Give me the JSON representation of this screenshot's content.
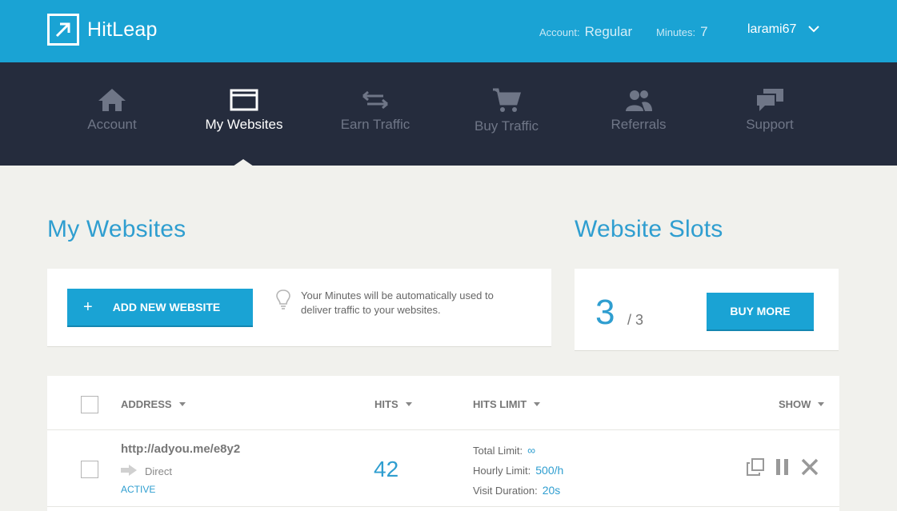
{
  "app": {
    "name": "HitLeap"
  },
  "header": {
    "account_label": "Account:",
    "account_type": "Regular",
    "minutes_label": "Minutes:",
    "minutes_value": "7",
    "username": "larami67"
  },
  "nav": {
    "items": [
      {
        "label": "Account",
        "icon": "home-icon"
      },
      {
        "label": "My Websites",
        "icon": "browser-window-icon",
        "active": true
      },
      {
        "label": "Earn Traffic",
        "icon": "exchange-arrows-icon"
      },
      {
        "label": "Buy Traffic",
        "icon": "shopping-cart-icon"
      },
      {
        "label": "Referrals",
        "icon": "users-icon"
      },
      {
        "label": "Support",
        "icon": "chat-bubbles-icon"
      }
    ]
  },
  "websites": {
    "title": "My Websites",
    "add_button": "ADD NEW WEBSITE",
    "hint": "Your Minutes will be automatically used to deliver traffic to your websites."
  },
  "slots": {
    "title": "Website Slots",
    "used": "3",
    "total": "/ 3",
    "buy_button": "BUY MORE"
  },
  "table": {
    "columns": {
      "address": "ADDRESS",
      "hits": "HITS",
      "hits_limit": "HITS LIMIT",
      "show": "SHOW"
    },
    "rows": [
      {
        "url": "http://adyou.me/e8y2",
        "traffic_type": "Direct",
        "status": "ACTIVE",
        "hits": "42",
        "total_limit_label": "Total Limit:",
        "total_limit": "∞",
        "hourly_limit_label": "Hourly Limit:",
        "hourly_limit": "500/h",
        "visit_duration_label": "Visit Duration:",
        "visit_duration": "20s"
      }
    ]
  },
  "colors": {
    "brand": "#1aa3d4",
    "nav_bg": "#252c3d",
    "accent_text": "#2f9ed0",
    "page_bg": "#f1f1ed"
  }
}
